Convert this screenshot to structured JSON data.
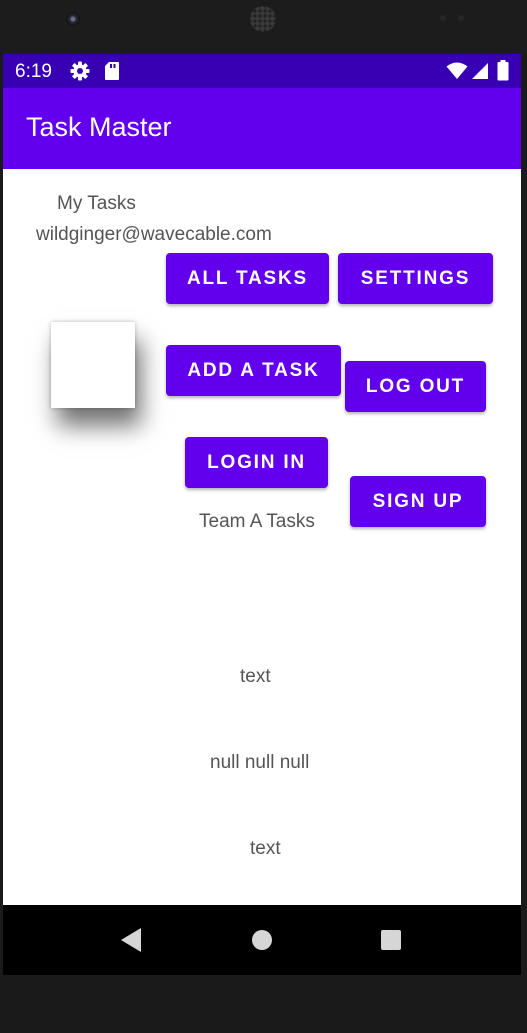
{
  "status_bar": {
    "time": "6:19",
    "icons": [
      "gear-icon",
      "sd-card-icon",
      "wifi-icon",
      "signal-icon",
      "battery-icon"
    ]
  },
  "app_bar": {
    "title": "Task Master"
  },
  "main": {
    "heading": "My Tasks",
    "username": "wildginger@wavecable.com",
    "buttons": {
      "all_tasks": "All Tasks",
      "settings": "Settings",
      "add_task": "Add a Task",
      "log_out": "Log Out",
      "login_in": "Login In",
      "sign_up": "Sign Up"
    },
    "team_label": "Team A Tasks",
    "text_1": "text",
    "null_text": "null null null",
    "text_2": "text"
  },
  "nav_bar": {
    "icons": [
      "back-icon",
      "home-icon",
      "recents-icon"
    ]
  },
  "colors": {
    "status_bar": "#3700b3",
    "app_bar": "#6200ee",
    "button": "#6200ee",
    "body_text": "#555555"
  }
}
